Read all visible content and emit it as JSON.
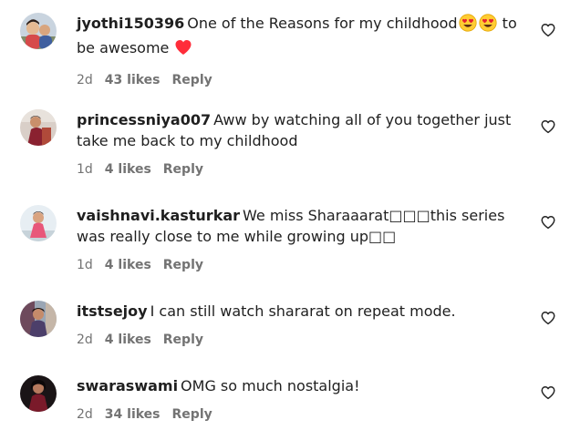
{
  "comments": [
    {
      "username": "jyothi150396",
      "text_before": "One of the Reasons for my childhood",
      "text_middle": " to be awesome ",
      "time": "2d",
      "likes": "43 likes",
      "reply": "Reply",
      "icons": [
        "heart-eyes-emoji",
        "heart-eyes-emoji",
        "red-heart-emoji"
      ]
    },
    {
      "username": "princessniya007",
      "text": "Aww by watching all of you together just take me back to my childhood",
      "time": "1d",
      "likes": "4 likes",
      "reply": "Reply"
    },
    {
      "username": "vaishnavi.kasturkar",
      "text": "We miss Sharaaarat□□□this series was really close to me while growing up□□",
      "time": "1d",
      "likes": "4 likes",
      "reply": "Reply"
    },
    {
      "username": "itstsejoy",
      "text": "I can still watch shararat on repeat mode.",
      "time": "2d",
      "likes": "4 likes",
      "reply": "Reply"
    },
    {
      "username": "swaraswami",
      "text": "OMG so much nostalgia!",
      "time": "2d",
      "likes": "34 likes",
      "reply": "Reply"
    }
  ],
  "colors": {
    "text": "#1f1f1f",
    "secondary": "#737373",
    "heart_red": "#ff2d3a",
    "emoji_yellow": "#ffcc33"
  }
}
